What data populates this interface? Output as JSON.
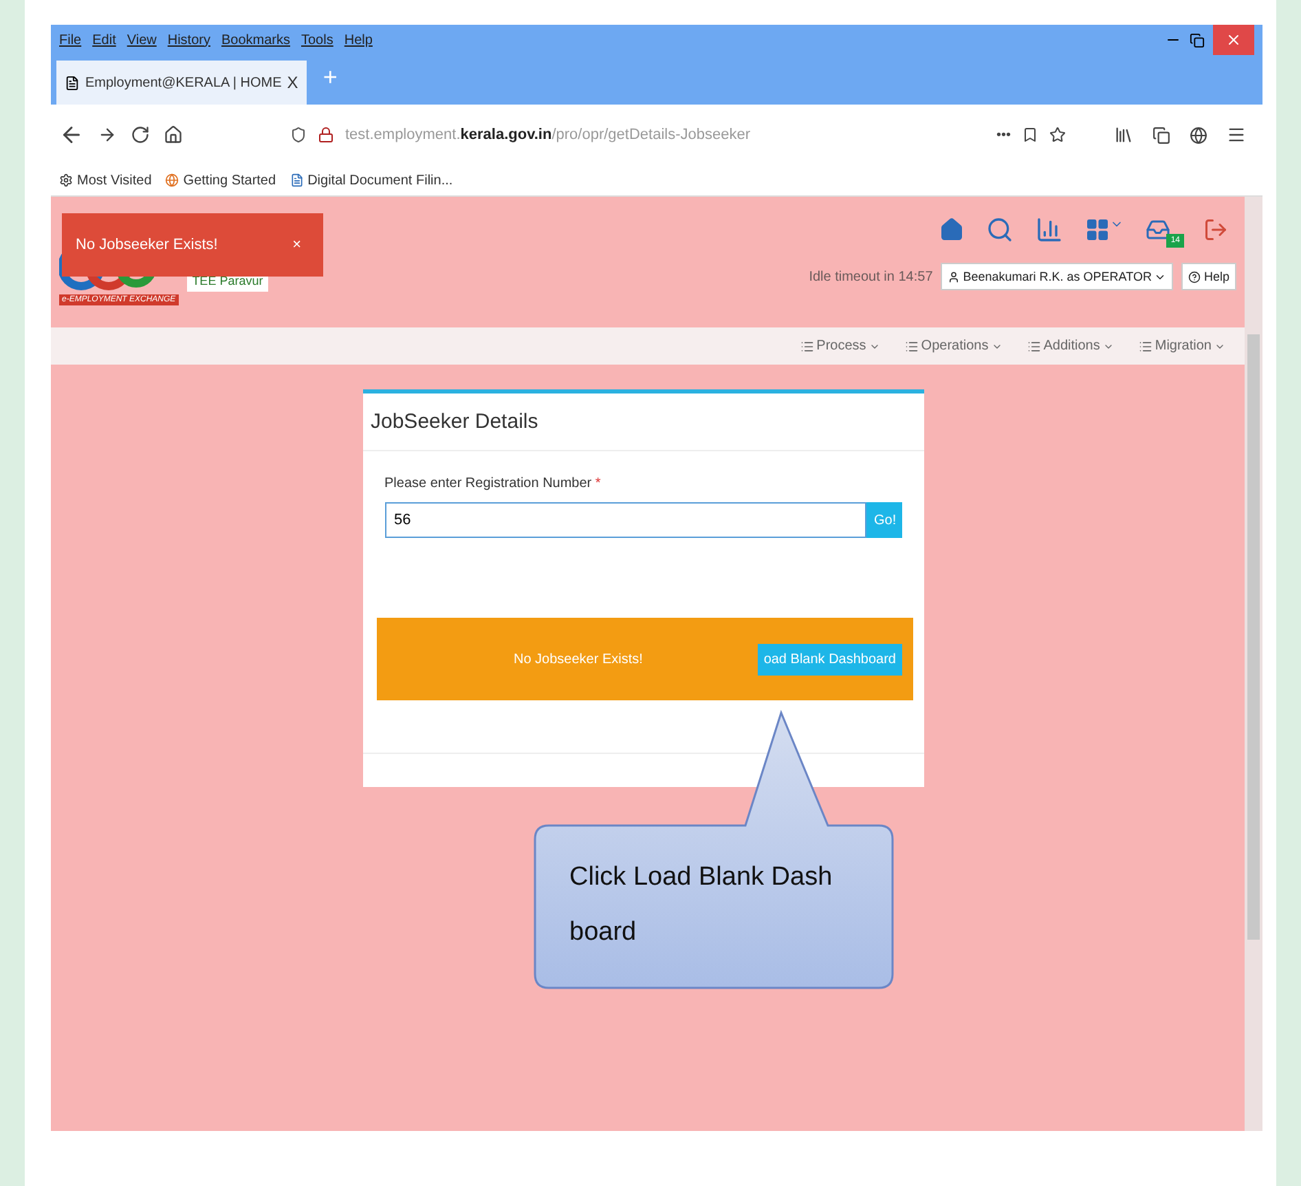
{
  "menu_bar": [
    "File",
    "Edit",
    "View",
    "History",
    "Bookmarks",
    "Tools",
    "Help"
  ],
  "tab": {
    "title": "Employment@KERALA | HOME",
    "close": "X",
    "new": "+"
  },
  "address_bar": {
    "url": "test.employment.**kerala.gov.in**/pro/opr/getDetails-Jobseeker",
    "more": "•••"
  },
  "bookmarks": [
    "Most Visited",
    "Getting Started",
    "Digital Document Filin..."
  ],
  "toast": {
    "message": "No Jobseeker Exists!",
    "close": "×"
  },
  "logo": {
    "caption": "e-EMPLOYMENT EXCHANGE"
  },
  "office": "TEE Paravur",
  "notification_count": "14",
  "idle_timeout": "Idle timeout in 14:57",
  "user_menu": "Beenakumari R.K. as OPERATOR",
  "help": "Help",
  "nav_menu": [
    "Process",
    "Operations",
    "Additions",
    "Migration"
  ],
  "card": {
    "title": "JobSeeker Details",
    "label": "Please enter Registration Number",
    "required": "*",
    "value": "56",
    "go": "Go!",
    "alert": {
      "message": "No Jobseeker Exists!",
      "button": "oad Blank Dashboard"
    }
  },
  "callout": "Click Load Blank Dash board"
}
